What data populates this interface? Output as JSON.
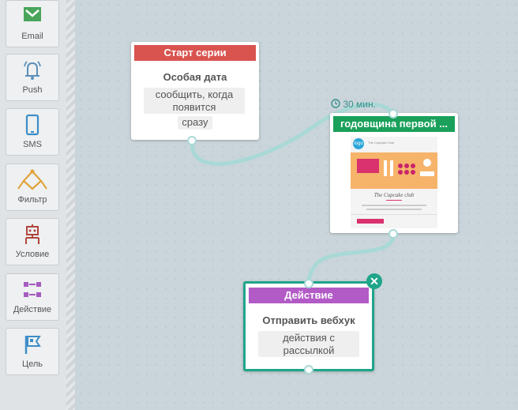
{
  "sidebar": {
    "tools": [
      {
        "label": "Email",
        "icon": "email-icon"
      },
      {
        "label": "Push",
        "icon": "bell-icon"
      },
      {
        "label": "SMS",
        "icon": "phone-icon"
      },
      {
        "label": "Фильтр",
        "icon": "filter-icon"
      },
      {
        "label": "Условие",
        "icon": "condition-icon"
      },
      {
        "label": "Действие",
        "icon": "action-icon"
      },
      {
        "label": "Цель",
        "icon": "flag-icon"
      }
    ]
  },
  "nodes": {
    "start": {
      "header": "Старт серии",
      "title": "Особая дата",
      "chip1": "сообщить, когда появится",
      "chip2": "сразу",
      "header_color": "#d9534f"
    },
    "email": {
      "header": "годовщина первой ...",
      "header_color": "#1aa05a",
      "delay": "30 мин.",
      "preview": {
        "logo": "logo",
        "brand": "The Cupcake Club",
        "heading": "The Cupcake club"
      }
    },
    "action": {
      "header": "Действие",
      "header_color": "#b25bc6",
      "title": "Отправить вебхук",
      "chip": "действия с рассылкой",
      "border_color": "#1fa58a"
    }
  },
  "colors": {
    "link": "#a9d9d6",
    "canvas": "#c9d5da"
  }
}
